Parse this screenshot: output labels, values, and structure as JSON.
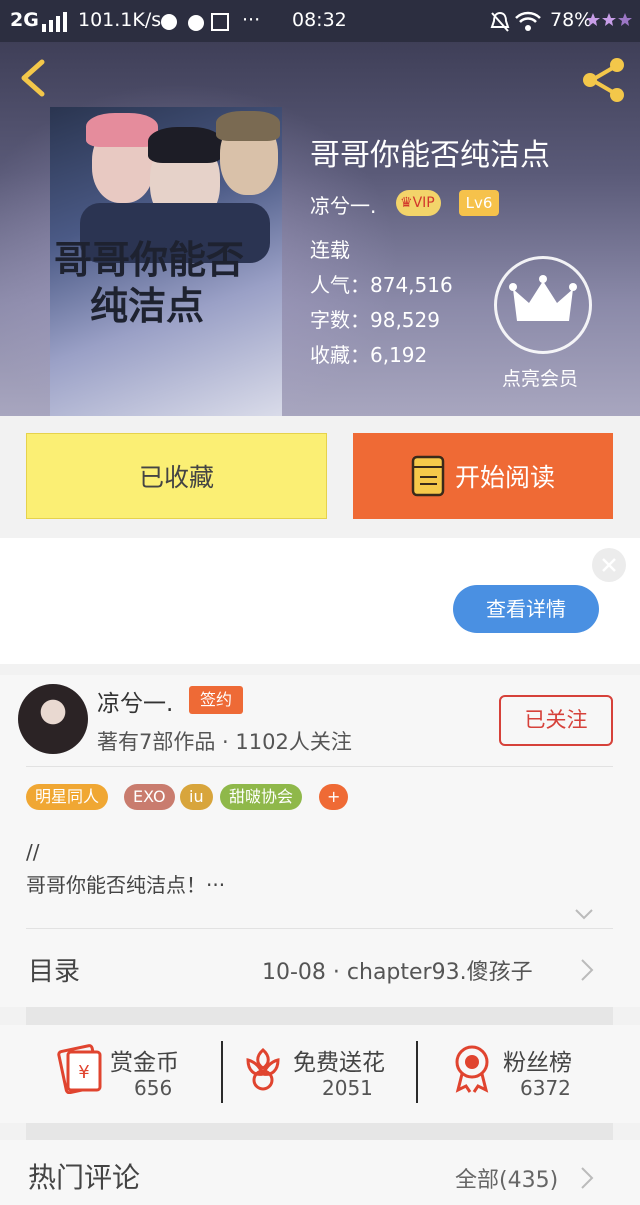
{
  "status_bar": {
    "network": "2G",
    "speed": "101.1K/s",
    "dots": "···",
    "time": "08:32",
    "battery": "78%"
  },
  "book": {
    "title": "哥哥你能否纯洁点",
    "author": "凉兮一.",
    "vip_label": "VIP",
    "level": "Lv6",
    "status": "连载",
    "popularity": "人气：874,516",
    "word_count": "字数：98,529",
    "favorites": "收藏：6,192",
    "member_label": "点亮会员",
    "cover_title_line1": "哥哥你能否",
    "cover_title_line2": "纯洁点"
  },
  "actions": {
    "favorited_label": "已收藏",
    "read_label": "开始阅读",
    "detail_label": "查看详情"
  },
  "author_card": {
    "name": "凉兮一.",
    "sign_badge": "签约",
    "stats": "著有7部作品 · 1102人关注",
    "follow_label": "已关注",
    "tags": [
      {
        "label": "明星同人",
        "color": "#f0a733"
      },
      {
        "label": "EXO",
        "color": "#c97c6e"
      },
      {
        "label": "iu",
        "color": "#d8a53c"
      },
      {
        "label": "甜啵协会",
        "color": "#8fb84a"
      },
      {
        "label": "+",
        "color": "#ef6a35"
      }
    ],
    "intro_line1": "//",
    "intro_line2": "哥哥你能否纯洁点！···"
  },
  "toc": {
    "label": "目录",
    "latest": "10-08 · chapter93.傻孩子"
  },
  "gifts": [
    {
      "title": "赏金币",
      "count": "656",
      "icon": "coin-envelope-icon"
    },
    {
      "title": "免费送花",
      "count": "2051",
      "icon": "flower-icon"
    },
    {
      "title": "粉丝榜",
      "count": "6372",
      "icon": "medal-icon"
    }
  ],
  "comments": {
    "title": "热门评论",
    "all_label": "全部(435)"
  },
  "colors": {
    "accent_orange": "#ef6a35",
    "favorite_yellow": "#fbef74",
    "detail_blue": "#4a90e2",
    "follow_red": "#d6413a"
  }
}
